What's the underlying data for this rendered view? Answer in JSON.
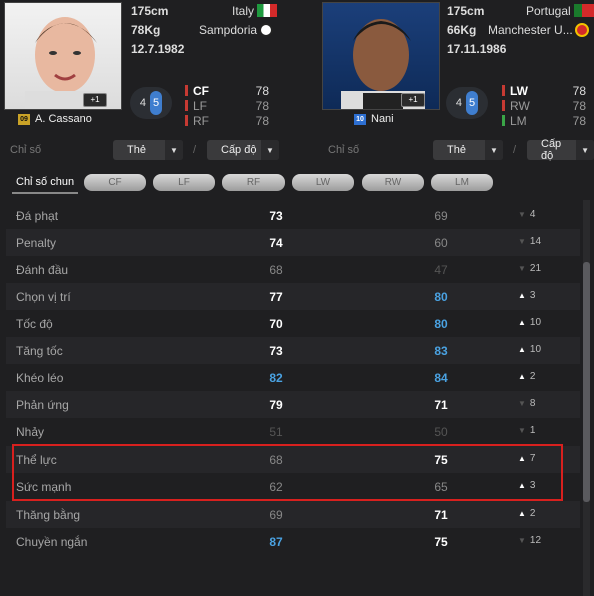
{
  "player_left": {
    "name": "A. Cassano",
    "number": "09",
    "height": "175cm",
    "weight": "78Kg",
    "birthdate": "12.7.1982",
    "country": "Italy",
    "club": "Sampdoria",
    "pill_a": "4",
    "pill_b": "5",
    "boost": "+1",
    "positions": [
      {
        "label": "CF",
        "value": "78"
      },
      {
        "label": "LF",
        "value": "78"
      },
      {
        "label": "RF",
        "value": "78"
      }
    ]
  },
  "player_right": {
    "name": "Nani",
    "number": "10",
    "height": "175cm",
    "weight": "66Kg",
    "birthdate": "17.11.1986",
    "country": "Portugal",
    "club": "Manchester U...",
    "pill_a": "4",
    "pill_b": "5",
    "boost": "+1",
    "positions": [
      {
        "label": "LW",
        "value": "78"
      },
      {
        "label": "RW",
        "value": "78"
      },
      {
        "label": "LM",
        "value": "78"
      }
    ]
  },
  "filters": {
    "chiso_label": "Chỉ số",
    "the_label": "Thẻ",
    "capdo_label": "Cấp độ",
    "slash": "/"
  },
  "tabs": [
    "Chỉ số chun",
    "CF",
    "LF",
    "RF",
    "LW",
    "RW",
    "LM"
  ],
  "stats": [
    {
      "name": "Đá phạt",
      "left": "73",
      "right": "69",
      "delta": "4",
      "dir": "down"
    },
    {
      "name": "Penalty",
      "left": "74",
      "right": "60",
      "delta": "14",
      "dir": "down"
    },
    {
      "name": "Đánh đầu",
      "left": "68",
      "right": "47",
      "delta": "21",
      "dir": "down"
    },
    {
      "name": "Chọn vị trí",
      "left": "77",
      "right": "80",
      "delta": "3",
      "dir": "up"
    },
    {
      "name": "Tốc độ",
      "left": "70",
      "right": "80",
      "delta": "10",
      "dir": "up"
    },
    {
      "name": "Tăng tốc",
      "left": "73",
      "right": "83",
      "delta": "10",
      "dir": "up"
    },
    {
      "name": "Khéo léo",
      "left": "82",
      "right": "84",
      "delta": "2",
      "dir": "up"
    },
    {
      "name": "Phản ứng",
      "left": "79",
      "right": "71",
      "delta": "8",
      "dir": "down"
    },
    {
      "name": "Nhảy",
      "left": "51",
      "right": "50",
      "delta": "1",
      "dir": "down"
    },
    {
      "name": "Thể lực",
      "left": "68",
      "right": "75",
      "delta": "7",
      "dir": "up"
    },
    {
      "name": "Sức mạnh",
      "left": "62",
      "right": "65",
      "delta": "3",
      "dir": "up"
    },
    {
      "name": "Thăng bằng",
      "left": "69",
      "right": "71",
      "delta": "2",
      "dir": "up"
    },
    {
      "name": "Chuyền ngắn",
      "left": "87",
      "right": "75",
      "delta": "12",
      "dir": "down"
    }
  ],
  "colors": {
    "highlight": "#d8201e",
    "blue_value": "#4aa2e2",
    "accent": "#3f7ecf"
  }
}
